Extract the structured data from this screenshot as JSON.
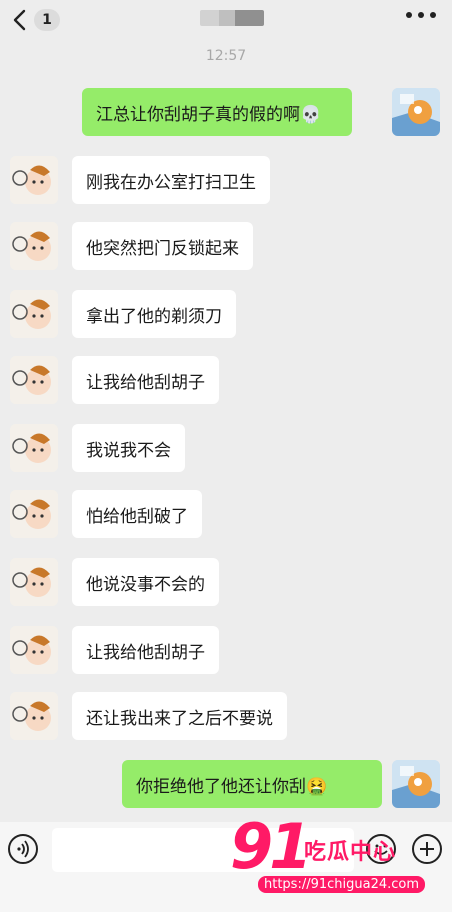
{
  "header": {
    "back_count": "1",
    "time": "12:57"
  },
  "messages": [
    {
      "dir": "out",
      "text": "江总让你刮胡子真的假的啊💀"
    },
    {
      "dir": "in",
      "text": "刚我在办公室打扫卫生"
    },
    {
      "dir": "in",
      "text": "他突然把门反锁起来"
    },
    {
      "dir": "in",
      "text": "拿出了他的剃须刀"
    },
    {
      "dir": "in",
      "text": "让我给他刮胡子"
    },
    {
      "dir": "in",
      "text": "我说我不会"
    },
    {
      "dir": "in",
      "text": "怕给他刮破了"
    },
    {
      "dir": "in",
      "text": "他说没事不会的"
    },
    {
      "dir": "in",
      "text": "让我给他刮胡子"
    },
    {
      "dir": "in",
      "text": "还让我出来了之后不要说"
    },
    {
      "dir": "out",
      "text": "你拒绝他了他还让你刮🤮"
    }
  ],
  "watermark": {
    "number": "91",
    "name": "吃瓜中心",
    "url": "https://91chigua24.com"
  },
  "icons": {
    "back": "chevron-left-icon",
    "more": "more-dots-icon",
    "voice": "voice-icon",
    "emoji": "emoji-icon",
    "plus": "plus-icon"
  },
  "colors": {
    "background": "#ededed",
    "outgoing_bubble": "#95ec69",
    "incoming_bubble": "#ffffff",
    "watermark": "#ff1a66"
  }
}
